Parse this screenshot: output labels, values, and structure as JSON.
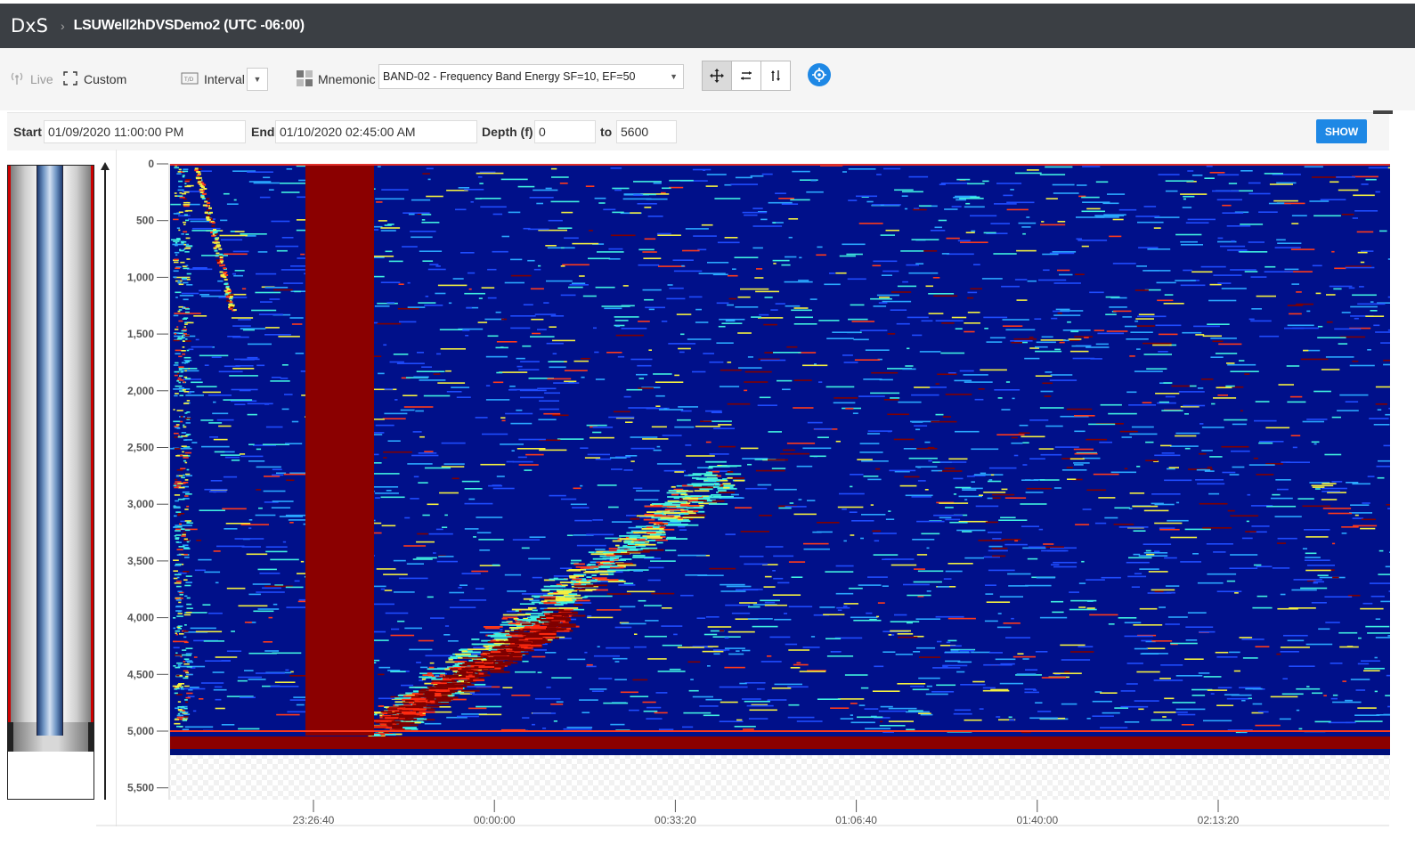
{
  "app": {
    "brand": "DxS",
    "title": "LSUWell2hDVSDemo2 (UTC -06:00)"
  },
  "toolbar": {
    "live_label": "Live",
    "custom_label": "Custom",
    "interval_label": "Interval",
    "mnemonic_label": "Mnemonic",
    "mnemonic_value": "BAND-02 - Frequency Band Energy SF=10, EF=50",
    "tools": [
      "pan-icon",
      "horizontal-zoom-icon",
      "vertical-zoom-icon",
      "locate-icon"
    ],
    "accent_color": "#1e88e5"
  },
  "filter": {
    "start_label": "Start",
    "start_value": "01/09/2020 11:00:00 PM",
    "end_label": "End",
    "end_value": "01/10/2020 02:45:00 AM",
    "depth_label": "Depth (f)",
    "depth_from": "0",
    "to_label": "to",
    "depth_to": "5600",
    "show_label": "SHOW"
  },
  "chart_data": {
    "type": "heatmap",
    "y_axis": {
      "ticks": [
        "0",
        "500",
        "1,000",
        "1,500",
        "2,000",
        "2,500",
        "3,000",
        "3,500",
        "4,000",
        "4,500",
        "5,000",
        "5,500"
      ],
      "range": [
        0,
        5600
      ],
      "inverted": true
    },
    "x_axis": {
      "ticks": [
        "23:26:40",
        "00:00:00",
        "00:33:20",
        "01:06:40",
        "01:40:00",
        "02:13:20"
      ],
      "range": [
        "01/09/2020 11:00:00 PM",
        "01/10/2020 02:45:00 AM"
      ]
    },
    "colormap": [
      "#00007f",
      "#0000ff",
      "#00ffff",
      "#ffff00",
      "#ff0000",
      "#7f0000"
    ],
    "background_color": "#00108a",
    "saturated_color": "#8b0000"
  }
}
